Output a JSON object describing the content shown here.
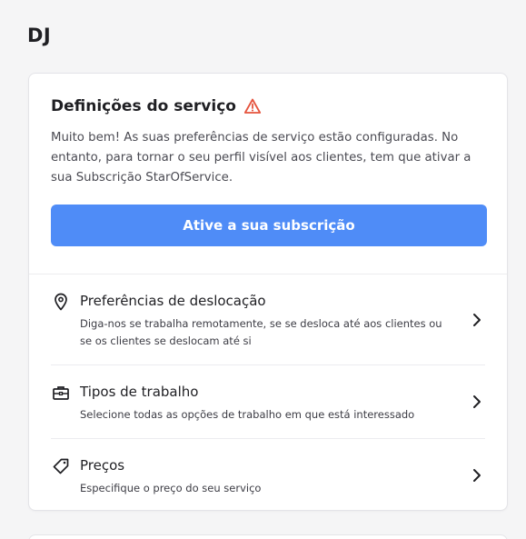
{
  "header": {
    "title": "DJ"
  },
  "service_card": {
    "title": "Definições do serviço",
    "warning_icon": "warning-triangle-icon",
    "warning_color": "#e5533d",
    "description": "Muito bem! As suas preferências de serviço estão configuradas. No entanto, para tornar o seu perfil visível aos clientes, tem que ativar a sua Subscrição StarOfService.",
    "cta_label": "Ative a sua subscrição",
    "cta_color": "#4f8cf7",
    "items": [
      {
        "icon": "location-pin-icon",
        "title": "Preferências de deslocação",
        "subtitle": "Diga-nos se trabalha remotamente, se se desloca até aos clientes ou se os clientes se deslocam até si"
      },
      {
        "icon": "briefcase-icon",
        "title": "Tipos de trabalho",
        "subtitle": "Selecione todas as opções de trabalho em que está interessado"
      },
      {
        "icon": "price-tag-icon",
        "title": "Preços",
        "subtitle": "Especifique o preço do seu serviço"
      }
    ]
  }
}
